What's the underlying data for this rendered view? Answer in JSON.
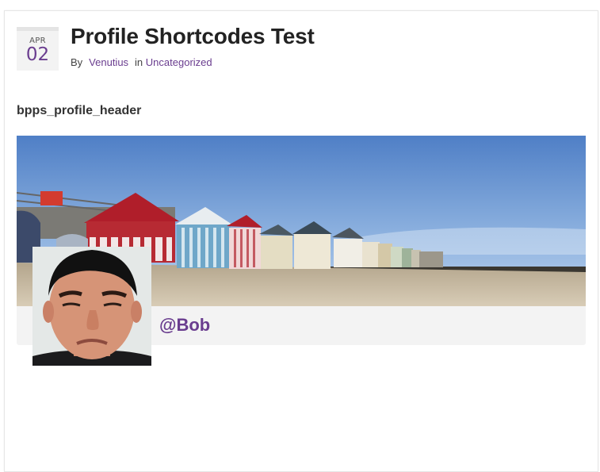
{
  "post": {
    "date": {
      "month": "APR",
      "day": "02"
    },
    "title": "Profile Shortcodes Test",
    "meta": {
      "by_label": "By",
      "author": "Venutius",
      "in_label": "in",
      "category": "Uncategorized"
    },
    "content": {
      "shortcode_label": "bpps_profile_header"
    }
  },
  "profile_header": {
    "cover_image": "beach-huts-cover-photo",
    "avatar_image": "user-avatar-photo",
    "username": "@Bob"
  },
  "colors": {
    "accent": "#6a3d8f",
    "title": "#222222",
    "name_bar": "#f3f3f3"
  }
}
